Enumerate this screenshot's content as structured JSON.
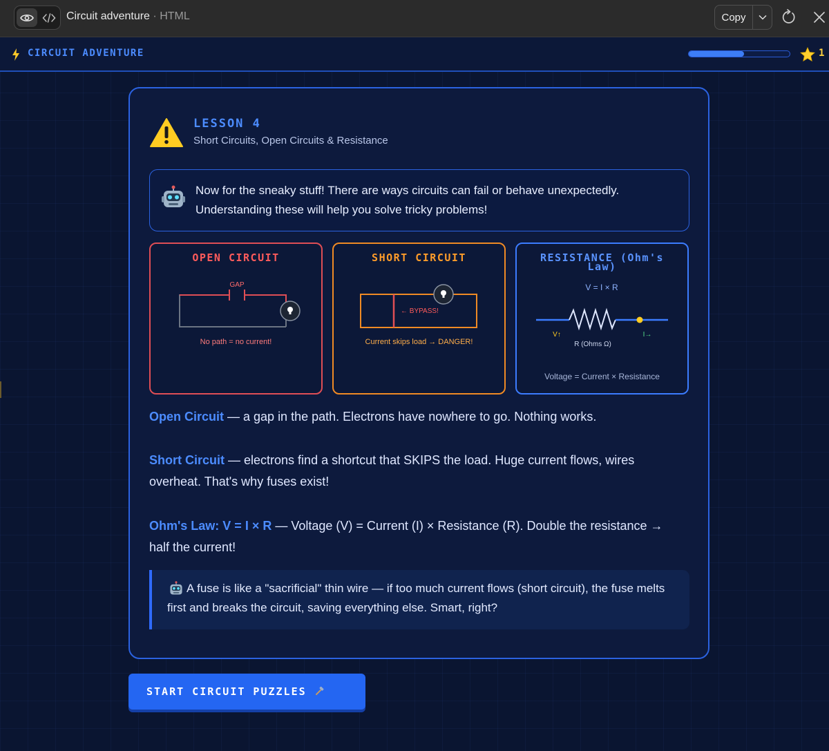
{
  "chrome": {
    "title": "Circuit adventure",
    "separator": "·",
    "kind": "HTML",
    "copy_label": "Copy",
    "icons": [
      "eye-icon",
      "code-icon",
      "chevron-down-icon",
      "reload-icon",
      "close-icon"
    ]
  },
  "header": {
    "bolt": "⚡",
    "title": "CIRCUIT ADVENTURE",
    "progress_fraction": 0.55,
    "stars": "1"
  },
  "lesson": {
    "number": "LESSON 4",
    "subtitle": "Short Circuits, Open Circuits & Resistance",
    "intro": "Now for the sneaky stuff! There are ways circuits can fail or behave unexpectedly. Understanding these will help you solve tricky problems!"
  },
  "panels": {
    "open": {
      "title": "OPEN CIRCUIT",
      "gap_label": "GAP",
      "caption": "No path = no current!"
    },
    "short": {
      "title": "SHORT CIRCUIT",
      "bypass_label": "← BYPASS!",
      "caption": "Current skips load → DANGER!"
    },
    "resistance": {
      "title": "RESISTANCE (Ohm's Law)",
      "formula": "V = I × R",
      "v_label": "V↑",
      "r_label": "R (Ohms Ω)",
      "i_label": "I→",
      "caption": "Voltage = Current × Resistance"
    }
  },
  "paragraphs": {
    "open_term": "Open Circuit",
    "open_text": " — a gap in the path. Electrons have nowhere to go. Nothing works.",
    "short_term": "Short Circuit",
    "short_text": " — electrons find a shortcut that SKIPS the load. Huge current flows, wires overheat. That's why fuses exist!",
    "ohm_term": "Ohm's Law: V = I × R",
    "ohm_text": " — Voltage (V) = Current (I) × Resistance (R). Double the resistance → half the current!"
  },
  "tip": {
    "text": "A fuse is like a \"sacrificial\" thin wire — if too much current flows (short circuit), the fuse melts first and breaks the circuit, saving everything else. Smart, right?"
  },
  "start_button": {
    "label": "START CIRCUIT PUZZLES",
    "icon": "hammer-icon"
  },
  "colors": {
    "accent": "#4c8cff",
    "open": "#e04e55",
    "short": "#f08a24",
    "resistance": "#3c7cff",
    "star": "#ffd23f"
  }
}
